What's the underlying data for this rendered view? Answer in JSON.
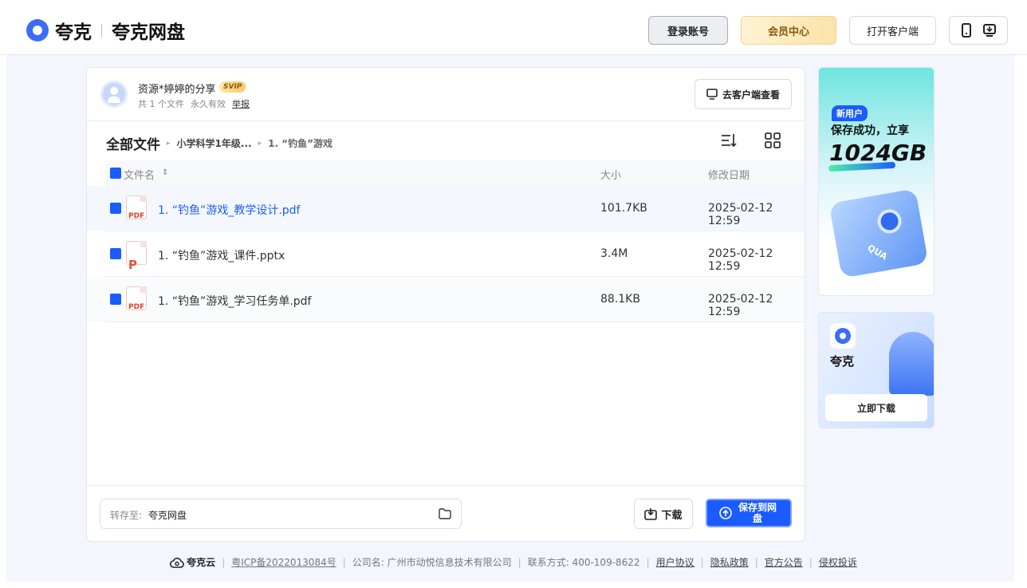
{
  "header": {
    "brand": "夸克",
    "product": "夸克网盘",
    "login_label": "登录账号",
    "vip_label": "会员中心",
    "open_client_label": "打开客户端"
  },
  "share": {
    "title": "资源*婷婷的分享",
    "badge": "SVIP",
    "file_count": "共 1 个文件",
    "validity": "永久有效",
    "report": "举报",
    "client_view_label": "去客户端查看"
  },
  "breadcrumb": {
    "root": "全部文件",
    "items": [
      "小学科学1年级...",
      "1. “钓鱼”游戏"
    ]
  },
  "table": {
    "headers": {
      "name": "文件名",
      "size": "大小",
      "date": "修改日期"
    },
    "rows": [
      {
        "type": "PDF",
        "name": "1. “钓鱼”游戏_教学设计.pdf",
        "size": "101.7KB",
        "date": "2025-02-12 12:59"
      },
      {
        "type": "P",
        "name": "1. “钓鱼”游戏_课件.pptx",
        "size": "3.4M",
        "date": "2025-02-12 12:59"
      },
      {
        "type": "PDF",
        "name": "1. “钓鱼”游戏_学习任务单.pdf",
        "size": "88.1KB",
        "date": "2025-02-12 12:59"
      }
    ]
  },
  "actions": {
    "save_to_label": "转存至:",
    "save_to_value": "夸克网盘",
    "download_label": "下载",
    "save_label": "保存到网盘"
  },
  "ads": {
    "ad1_tag": "新用户",
    "ad1_line": "保存成功，立享",
    "ad1_big": "1024GB",
    "ad1_brand": "QUA",
    "ad2_brand": "夸克",
    "ad2_button": "立即下载"
  },
  "footer": {
    "brand": "夸克云",
    "icp": "粤ICP备2022013084号",
    "company": "公司名: 广州市动悦信息技术有限公司",
    "contact": "联系方式: 400-109-8622",
    "links": [
      "用户协议",
      "隐私政策",
      "官方公告",
      "侵权投诉"
    ]
  },
  "colors": {
    "accent": "#1a5cff",
    "page_bg": "#f3f6fd",
    "vip": "#f9dfa0"
  }
}
